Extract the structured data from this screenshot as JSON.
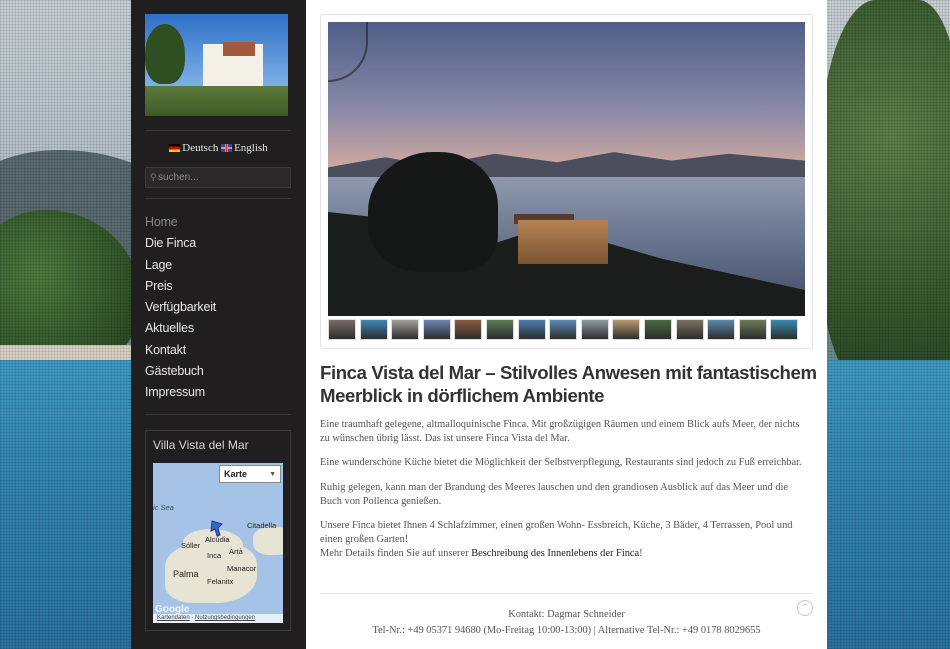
{
  "language_switcher": {
    "items": [
      {
        "label": "Deutsch",
        "flag": "de-flag-icon"
      },
      {
        "label": "English",
        "flag": "uk-flag-icon"
      }
    ]
  },
  "search": {
    "placeholder": "suchen..."
  },
  "nav": {
    "items": [
      {
        "label": "Home",
        "active": true
      },
      {
        "label": "Die Finca"
      },
      {
        "label": "Lage"
      },
      {
        "label": "Preis"
      },
      {
        "label": "Verfügbarkeit"
      },
      {
        "label": "Aktuelles"
      },
      {
        "label": "Kontakt"
      },
      {
        "label": "Gästebuch"
      },
      {
        "label": "Impressum"
      }
    ]
  },
  "widget": {
    "title": "Villa Vista del Mar",
    "map": {
      "type_control": "Karte",
      "labels": [
        "ic Sea",
        "Citadella",
        "Alcúdia",
        "Sóller",
        "Inca",
        "Artà",
        "Manacor",
        "Palma",
        "Felanitx"
      ],
      "logo": "Google",
      "footer_links": [
        "Kartendaten",
        "Nutzungsbedingungen"
      ]
    }
  },
  "gallery": {
    "thumb_count": 15,
    "thumb_colors": [
      "#7a6a66",
      "#3f86b8",
      "#a5a09a",
      "#6a86b0",
      "#8a5a3c",
      "#5c7a56",
      "#4d7db4",
      "#5a8ab8",
      "#8a9aa6",
      "#b89a6e",
      "#4a6a3c",
      "#7c7060",
      "#5a8aa8",
      "#6a7a5a",
      "#3a8ab0"
    ]
  },
  "content": {
    "heading": "Finca Vista del Mar – Stilvolles Anwesen mit fantastischem Meerblick in dörflichem Ambiente",
    "p1": "Eine traumhaft gelegene, altmalloquinische Finca.  Mit großzügigen Räumen und einem Blick aufs Meer, der nichts zu wünschen übrig lässt. Das ist unsere Finca Vista del Mar.",
    "p2": "Eine wunderschöne Küche bietet die Möglichkeit der Selbstverpflegung, Restaurants sind jedoch zu Fuß erreichbar.",
    "p3": "Ruhig gelegen, kann man der Brandung des Meeres lauschen und den grandiosen Ausblick auf das Meer und die Buch von Pollenca genießen.",
    "p4_line1": "Unsere Finca bietet Ihnen 4 Schlafzimmer, einen großen Wohn- Essbreich, Küche, 3 Bäder, 4 Terrassen, Pool und einen großen Garten!",
    "p4_line2_prefix": "Mehr Details finden Sie auf unserer ",
    "p4_link": "Beschreibung des Innenlebens der Finca",
    "p4_suffix": "!"
  },
  "footer": {
    "contact_line": "Kontakt: Dagmar Schneider",
    "phone_line": "Tel-Nr.: +49 05371 94680 (Mo-Freitag 10:00-13:00) | Alternative Tel-Nr.: +49 0178 8029655",
    "to_top_icon": "chevron-up-icon"
  }
}
